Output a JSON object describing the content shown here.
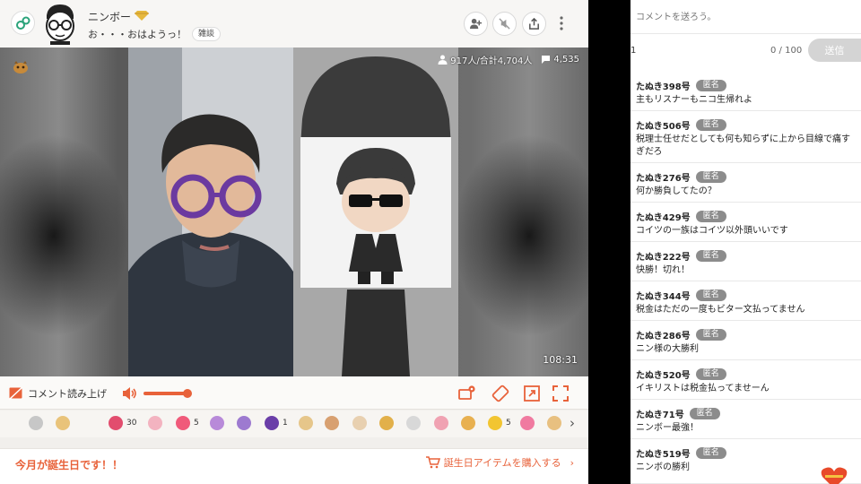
{
  "header": {
    "owner_name": "ニンボー",
    "broadcast_title": "お・・・おはようっ！",
    "tag": "雑談",
    "icons": [
      "community-icon",
      "owner-avatar",
      "premium-diamond-icon",
      "add-user-icon",
      "mute-icon",
      "share-icon",
      "more-icon"
    ]
  },
  "player": {
    "viewers": "917人/合計4,704人",
    "comments": "4,535",
    "elapsed": "108:31"
  },
  "controls": {
    "tts_label": "コメント読み上げ",
    "volume_level": 0.9
  },
  "gifts": [
    {
      "icon": "gift-bowl",
      "color": "#c7c7c7",
      "count": ""
    },
    {
      "icon": "gift-cake",
      "color": "#e9c37a",
      "count": ""
    },
    {
      "icon": "gift-heart-bear",
      "color": "#e24d6e",
      "count": "30"
    },
    {
      "icon": "gift-rose",
      "color": "#f3b3c0",
      "count": ""
    },
    {
      "icon": "gift-heart",
      "color": "#f05a7a",
      "count": "5"
    },
    {
      "icon": "gift-candy",
      "color": "#b88ad9",
      "count": ""
    },
    {
      "icon": "gift-ball",
      "color": "#9d7ad0",
      "count": ""
    },
    {
      "icon": "gift-donut",
      "color": "#6a3ea8",
      "count": "1"
    },
    {
      "icon": "gift-cookie",
      "color": "#e6c68a",
      "count": ""
    },
    {
      "icon": "gift-pudding",
      "color": "#d8a070",
      "count": ""
    },
    {
      "icon": "gift-cup",
      "color": "#e8d0b0",
      "count": ""
    },
    {
      "icon": "gift-box",
      "color": "#e2b04a",
      "count": ""
    },
    {
      "icon": "gift-ghost",
      "color": "#d8d8d8",
      "count": ""
    },
    {
      "icon": "gift-pig",
      "color": "#f0a2b2",
      "count": ""
    },
    {
      "icon": "gift-coin",
      "color": "#e8b050",
      "count": ""
    },
    {
      "icon": "gift-balloon",
      "color": "#f2c531",
      "count": "5"
    },
    {
      "icon": "gift-present",
      "color": "#f07aa0",
      "count": ""
    },
    {
      "icon": "gift-flag",
      "color": "#e8c080",
      "count": ""
    }
  ],
  "birthday": {
    "title": "今月が誕生日です！！",
    "link": "誕生日アイテムを購入する"
  },
  "comment_panel": {
    "placeholder": "コメントを送ろう。",
    "one": "1",
    "counter": "0 / 100",
    "send": "送信",
    "anon_label": "匿名",
    "comments": [
      {
        "name": "たぬき398号",
        "text": "主もリスナーもニコ生帰れよ"
      },
      {
        "name": "たぬき506号",
        "text": "税理士任せだとしても何も知らずに上から目線で痛すぎだろ"
      },
      {
        "name": "たぬき276号",
        "text": "何か勝負してたの？"
      },
      {
        "name": "たぬき429号",
        "text": "コイツの一族はコイツ以外頭いいです"
      },
      {
        "name": "たぬき222号",
        "text": "快勝！切れ！"
      },
      {
        "name": "たぬき344号",
        "text": "税金はただの一度もビター文払ってません"
      },
      {
        "name": "たぬき286号",
        "text": "ニン様の大勝利"
      },
      {
        "name": "たぬき520号",
        "text": "イキリストは税金払ってませーん"
      },
      {
        "name": "たぬき71号",
        "text": "ニンボー最強！"
      },
      {
        "name": "たぬき519号",
        "text": "ニンボの勝利"
      }
    ]
  },
  "colors": {
    "accent": "#e8623a",
    "anon_badge": "#8c8c8c"
  }
}
